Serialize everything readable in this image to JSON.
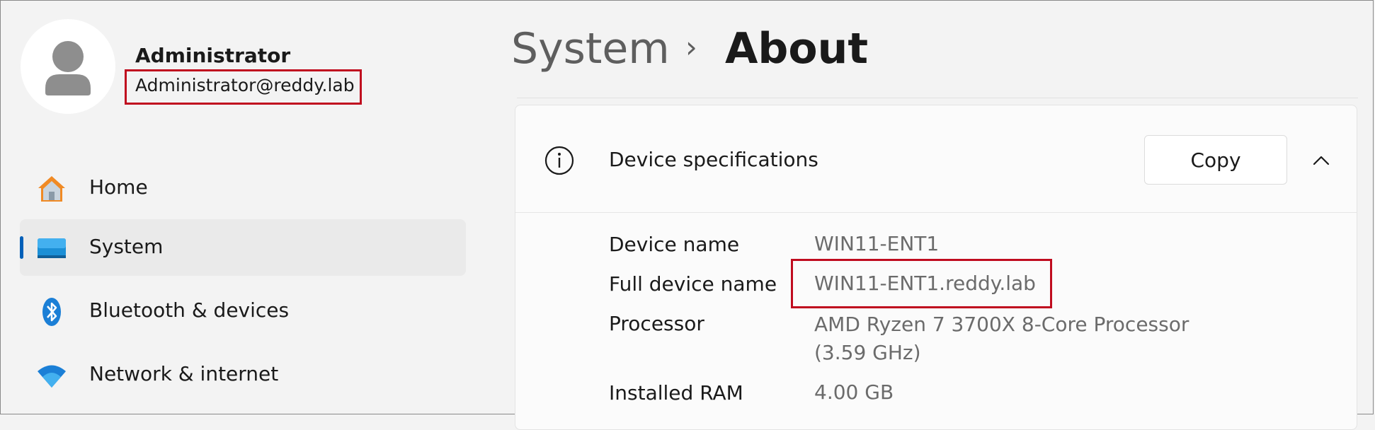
{
  "profile": {
    "name": "Administrator",
    "email": "Administrator@reddy.lab"
  },
  "nav": {
    "items": [
      {
        "label": "Home",
        "icon": "home-icon"
      },
      {
        "label": "System",
        "icon": "monitor-icon",
        "selected": true
      },
      {
        "label": "Bluetooth & devices",
        "icon": "bluetooth-icon"
      },
      {
        "label": "Network & internet",
        "icon": "wifi-icon"
      }
    ]
  },
  "breadcrumb": {
    "parent": "System",
    "separator": "›",
    "current": "About"
  },
  "device_specs": {
    "title": "Device specifications",
    "copy_label": "Copy",
    "rows": [
      {
        "label": "Device name",
        "value": "WIN11-ENT1"
      },
      {
        "label": "Full device name",
        "value": "WIN11-ENT1.reddy.lab"
      },
      {
        "label": "Processor",
        "value_line1": "AMD Ryzen 7 3700X 8-Core Processor",
        "value_line2": "(3.59 GHz)"
      },
      {
        "label": "Installed RAM",
        "value": "4.00 GB"
      }
    ]
  },
  "colors": {
    "accent": "#005fb8",
    "highlight": "#c00c1f",
    "background": "#f3f3f3"
  }
}
